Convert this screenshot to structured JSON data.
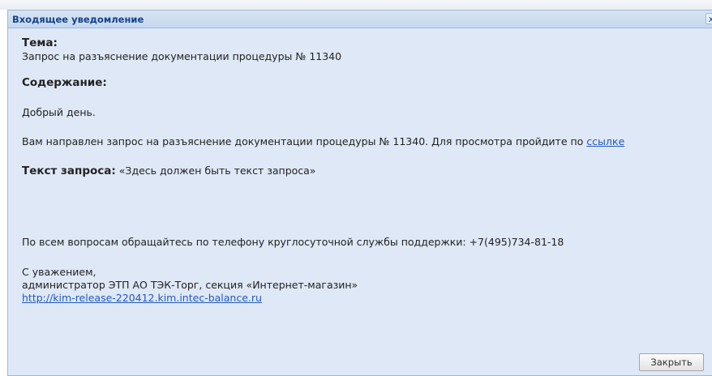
{
  "window": {
    "title": "Входящее уведомление",
    "close_glyph": "x"
  },
  "notification": {
    "subject_label": "Тема:",
    "subject": "Запрос на разъяснение документации процедуры № 11340",
    "content_label": "Содержание:",
    "greeting": "Добрый день.",
    "message_text": "Вам направлен запрос на разъяснение документации процедуры № 11340. Для просмотра пройдите по",
    "message_link": "ссылке",
    "request_label": "Текст запроса:",
    "request_text": "«Здесь должен быть текст запроса»",
    "support_text": "По всем вопросам обращайтесь по телефону круглосуточной службы поддержки: +7(495)734-81-18",
    "regards": "С уважением,",
    "signature": "администратор ЭТП АО ТЭК-Торг, секция «Интернет-магазин»",
    "site_link": "http://kim-release-220412.kim.intec-balance.ru"
  },
  "buttons": {
    "close_label": "Закрыть"
  }
}
